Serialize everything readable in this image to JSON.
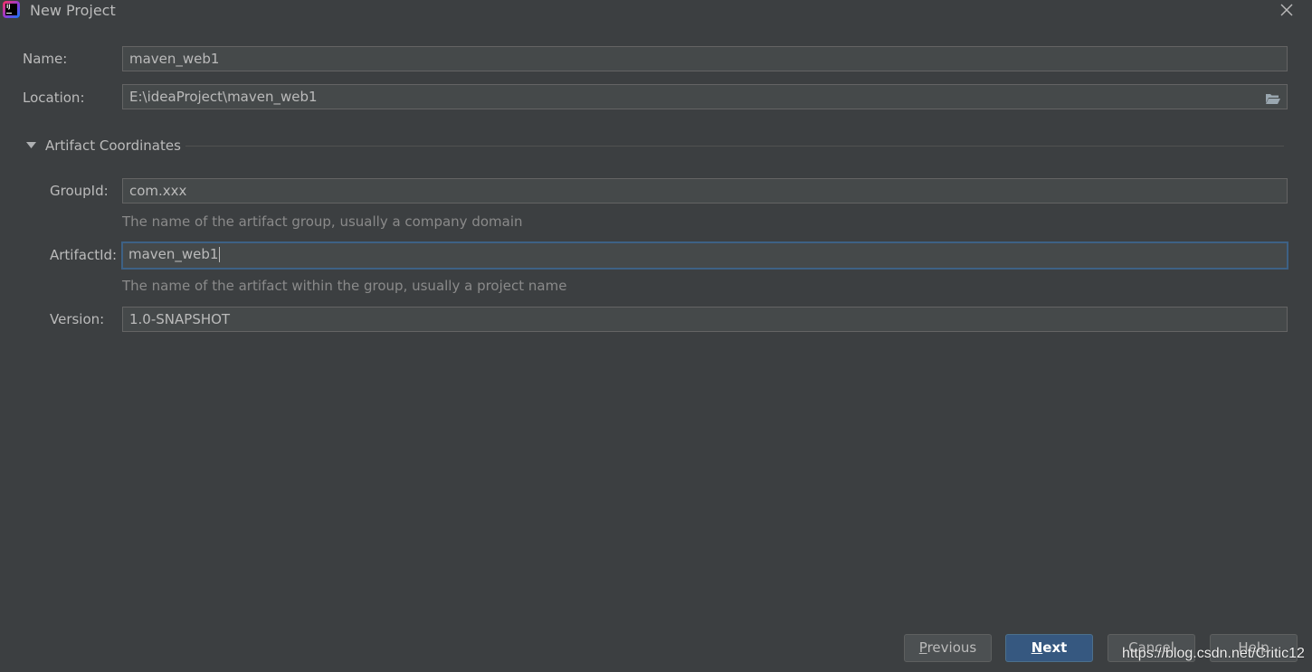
{
  "window": {
    "title": "New Project",
    "app_icon": "intellij-idea-icon",
    "close_icon": "close-icon"
  },
  "form": {
    "name_label": "Name:",
    "name_value": "maven_web1",
    "location_label": "Location:",
    "location_value": "E:\\ideaProject\\maven_web1",
    "browse_icon": "folder-open-icon"
  },
  "artifact": {
    "section_title": "Artifact Coordinates",
    "expanded": true,
    "groupid_label": "GroupId:",
    "groupid_value": "com.xxx",
    "groupid_hint": "The name of the artifact group, usually a company domain",
    "artifactid_label": "ArtifactId:",
    "artifactid_value": "maven_web1",
    "artifactid_hint": "The name of the artifact within the group, usually a project name",
    "version_label": "Version:",
    "version_value": "1.0-SNAPSHOT"
  },
  "buttons": {
    "previous_mnemonic": "P",
    "previous_rest": "revious",
    "next_mnemonic": "N",
    "next_rest": "ext",
    "cancel": "Cancel",
    "help": "Help"
  },
  "watermark": "https://blog.csdn.net/Critic12",
  "colors": {
    "background": "#3c3f41",
    "field": "#45494a",
    "focus_border": "#3d6185",
    "primary_button": "#365880"
  }
}
